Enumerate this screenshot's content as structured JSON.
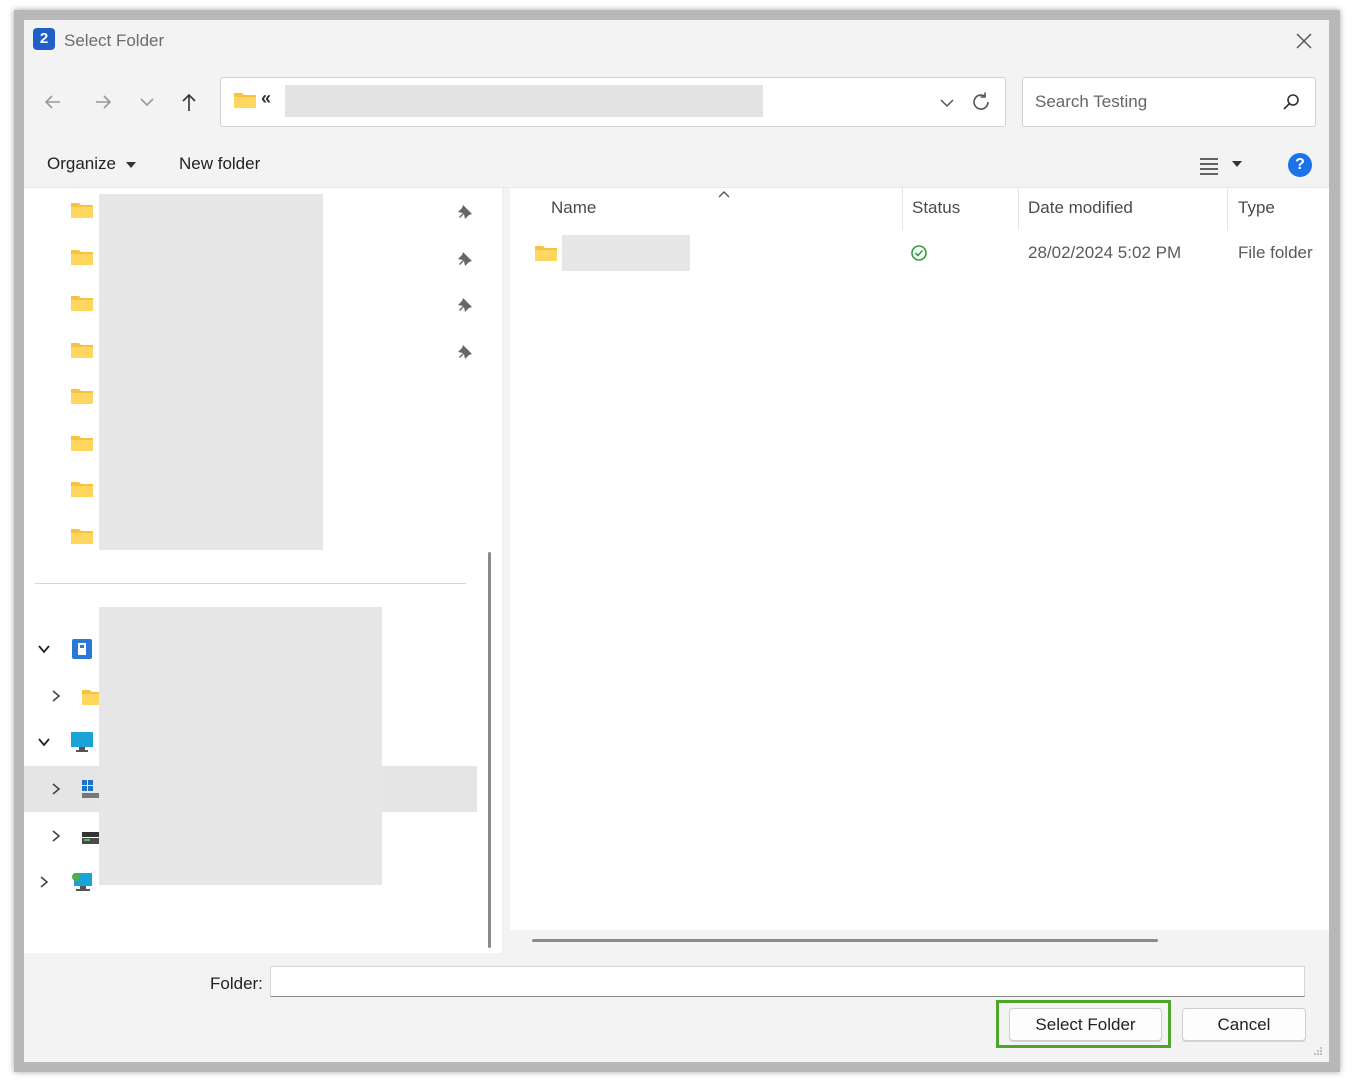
{
  "window": {
    "title": "Select Folder",
    "app_icon": "app-icon",
    "accent": "#1f5fc7"
  },
  "address_bar": {
    "overflow_glyph": "«"
  },
  "search": {
    "placeholder": "Search Testing"
  },
  "toolbar": {
    "organize": "Organize",
    "new_folder": "New folder"
  },
  "columns": {
    "name": "Name",
    "status": "Status",
    "date_modified": "Date modified",
    "type": "Type"
  },
  "files": [
    {
      "name": "",
      "status": "synced",
      "date_modified": "28/02/2024 5:02 PM",
      "type": "File folder"
    }
  ],
  "bottom": {
    "folder_label": "Folder:",
    "folder_value": "",
    "select_button": "Select Folder",
    "cancel_button": "Cancel",
    "highlight_color": "#4ea52b"
  }
}
